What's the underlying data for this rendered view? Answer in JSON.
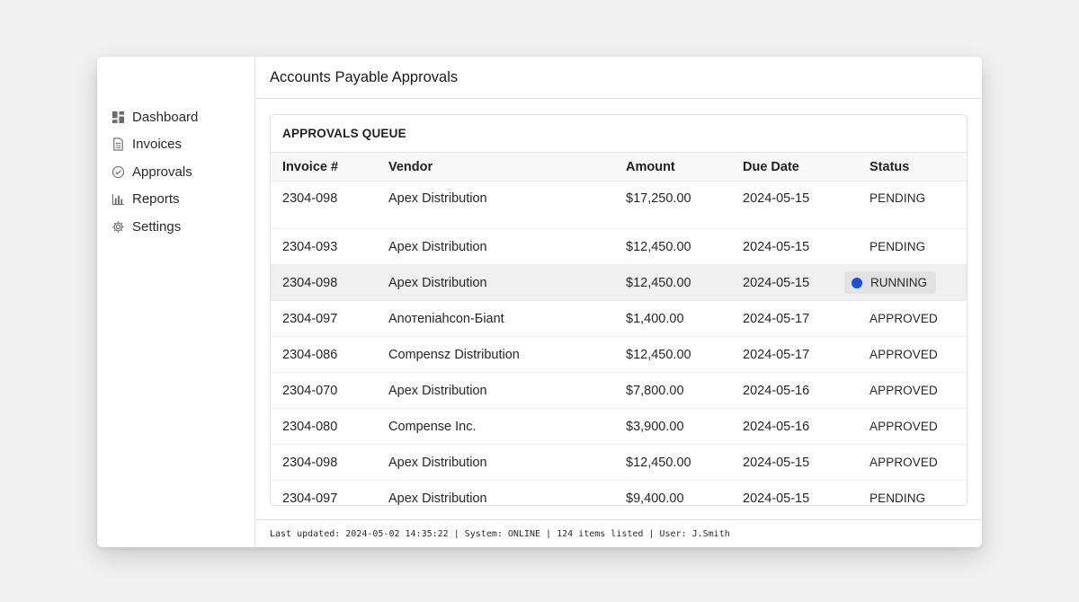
{
  "sidebar": {
    "items": [
      {
        "label": "Dashboard",
        "icon": "dashboard-icon"
      },
      {
        "label": "Invoices",
        "icon": "document-icon"
      },
      {
        "label": "Approvals",
        "icon": "check-circle-icon"
      },
      {
        "label": "Reports",
        "icon": "bar-chart-icon"
      },
      {
        "label": "Settings",
        "icon": "gear-icon"
      }
    ]
  },
  "header": {
    "title": "Accounts Payable Approvals"
  },
  "queue": {
    "title": "APPROVALS QUEUE",
    "columns": [
      "Invoice #",
      "Vendor",
      "Amount",
      "Due Date",
      "Status"
    ],
    "rows": [
      {
        "invoice": "2304-098",
        "vendor": "Apex Distribution",
        "amount": "$17,250.00",
        "due": "2024-05-15",
        "status": "PENDING"
      },
      {
        "invoice": "2304-093",
        "vendor": "Apex Distribution",
        "amount": "$12,450.00",
        "due": "2024-05-15",
        "status": "PENDING"
      },
      {
        "invoice": "2304-098",
        "vendor": "Apex Distribution",
        "amount": "$12,450.00",
        "due": "2024-05-15",
        "status": "RUNNING"
      },
      {
        "invoice": "2304-097",
        "vendor": "Anотeniahcon-Бiant",
        "amount": "$1,400.00",
        "due": "2024-05-17",
        "status": "APPROVED"
      },
      {
        "invoice": "2304-086",
        "vendor": "Compensz Distribution",
        "amount": "$12,450.00",
        "due": "2024-05-17",
        "status": "APPROVED"
      },
      {
        "invoice": "2304-070",
        "vendor": "Apex Distribution",
        "amount": "$7,800.00",
        "due": "2024-05-16",
        "status": "APPROVED"
      },
      {
        "invoice": "2304-080",
        "vendor": "Compense Inc.",
        "amount": "$3,900.00",
        "due": "2024-05-16",
        "status": "APPROVED"
      },
      {
        "invoice": "2304-098",
        "vendor": "Apex Distribution",
        "amount": "$12,450.00",
        "due": "2024-05-15",
        "status": "APPROVED"
      },
      {
        "invoice": "2304-097",
        "vendor": "Apex Distribution",
        "amount": "$9,400.00",
        "due": "2024-05-15",
        "status": "PENDING"
      }
    ]
  },
  "footer": {
    "status": "Last updated: 2024-05-02 14:35:22 | System: ONLINE | 124 items listed | User: J.Smith"
  },
  "colors": {
    "running_dot": "#1a4fe0",
    "selected_row": "#f0f0f0"
  }
}
